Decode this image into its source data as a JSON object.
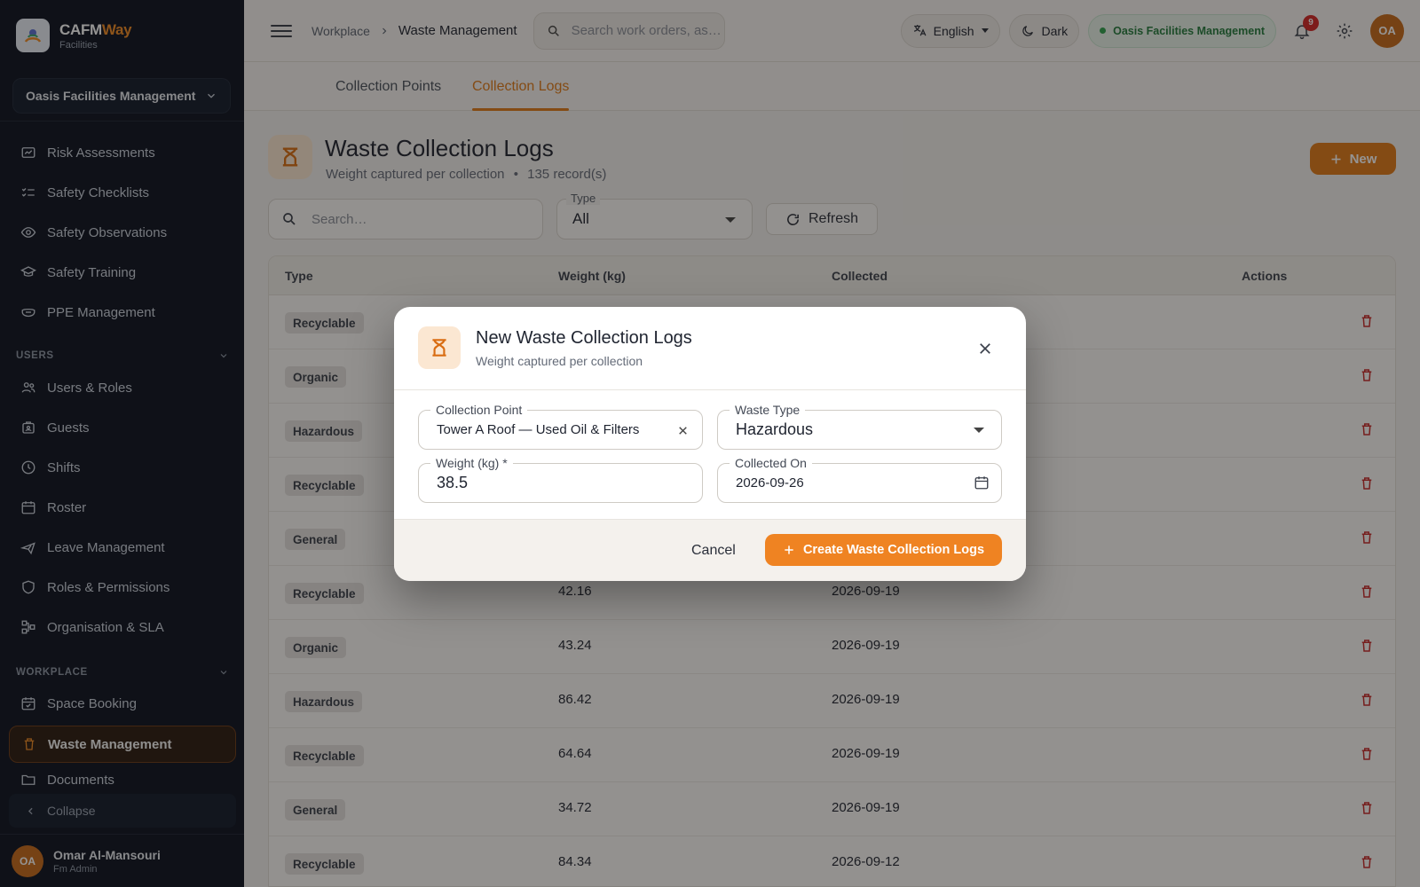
{
  "brand": {
    "name_main": "CAFM",
    "name_accent": "Way",
    "subtitle": "Facilities"
  },
  "org_selector": {
    "label": "Oasis Facilities Management"
  },
  "sidebar": {
    "items_top": [
      {
        "label": "Risk Assessments",
        "icon": "risk-icon"
      },
      {
        "label": "Safety Checklists",
        "icon": "checklist-icon"
      },
      {
        "label": "Safety Observations",
        "icon": "eye-icon"
      },
      {
        "label": "Safety Training",
        "icon": "graduation-icon"
      },
      {
        "label": "PPE Management",
        "icon": "mask-icon"
      }
    ],
    "section_users": "USERS",
    "items_users": [
      {
        "label": "Users & Roles",
        "icon": "users-icon"
      },
      {
        "label": "Guests",
        "icon": "badge-icon"
      },
      {
        "label": "Shifts",
        "icon": "clock-icon"
      },
      {
        "label": "Roster",
        "icon": "calendar-icon"
      },
      {
        "label": "Leave Management",
        "icon": "plane-icon"
      },
      {
        "label": "Roles & Permissions",
        "icon": "shield-icon"
      },
      {
        "label": "Organisation & SLA",
        "icon": "org-icon"
      }
    ],
    "section_workplace": "WORKPLACE",
    "items_workplace": [
      {
        "label": "Space Booking",
        "icon": "calendar-check-icon"
      },
      {
        "label": "Waste Management",
        "icon": "trash-icon",
        "active": true
      },
      {
        "label": "Documents",
        "icon": "folder-icon"
      }
    ],
    "collapse_label": "Collapse",
    "user": {
      "initials": "OA",
      "name": "Omar Al-Mansouri",
      "role": "Fm Admin"
    }
  },
  "topbar": {
    "breadcrumb_parent": "Workplace",
    "breadcrumb_current": "Waste Management",
    "search_placeholder": "Search work orders, as…",
    "language": "English",
    "theme": "Dark",
    "org": "Oasis Facilities Management",
    "notifications": "9",
    "avatar": "OA"
  },
  "tabs": [
    {
      "label": "Collection Points"
    },
    {
      "label": "Collection Logs",
      "active": true
    }
  ],
  "page": {
    "title": "Waste Collection Logs",
    "subtitle": "Weight captured per collection",
    "separator": "•",
    "records": "135 record(s)",
    "new_label": "New"
  },
  "filters": {
    "search_placeholder": "Search…",
    "type_label": "Type",
    "type_value": "All",
    "refresh_label": "Refresh"
  },
  "table": {
    "columns": {
      "type": "Type",
      "weight": "Weight (kg)",
      "collected": "Collected",
      "actions": "Actions"
    },
    "rows": [
      {
        "type": "Recyclable",
        "weight": "",
        "collected": ""
      },
      {
        "type": "Organic",
        "weight": "",
        "collected": ""
      },
      {
        "type": "Hazardous",
        "weight": "",
        "collected": ""
      },
      {
        "type": "Recyclable",
        "weight": "",
        "collected": ""
      },
      {
        "type": "General",
        "weight": "",
        "collected": ""
      },
      {
        "type": "Recyclable",
        "weight": "42.16",
        "collected": "2026-09-19"
      },
      {
        "type": "Organic",
        "weight": "43.24",
        "collected": "2026-09-19"
      },
      {
        "type": "Hazardous",
        "weight": "86.42",
        "collected": "2026-09-19"
      },
      {
        "type": "Recyclable",
        "weight": "64.64",
        "collected": "2026-09-19"
      },
      {
        "type": "General",
        "weight": "34.72",
        "collected": "2026-09-19"
      },
      {
        "type": "Recyclable",
        "weight": "84.34",
        "collected": "2026-09-12"
      }
    ]
  },
  "modal": {
    "title": "New Waste Collection Logs",
    "subtitle": "Weight captured per collection",
    "collection_point_label": "Collection Point",
    "collection_point_value": "Tower A Roof — Used Oil & Filters",
    "waste_type_label": "Waste Type",
    "waste_type_value": "Hazardous",
    "weight_label": "Weight (kg) *",
    "weight_value": "38.5",
    "collected_on_label": "Collected On",
    "collected_on_value": "2026-09-26",
    "cancel_label": "Cancel",
    "create_label": "Create Waste Collection Logs"
  },
  "colors": {
    "accent": "#e07a18",
    "sidebar_bg": "#0b1220",
    "danger": "#c62828"
  }
}
